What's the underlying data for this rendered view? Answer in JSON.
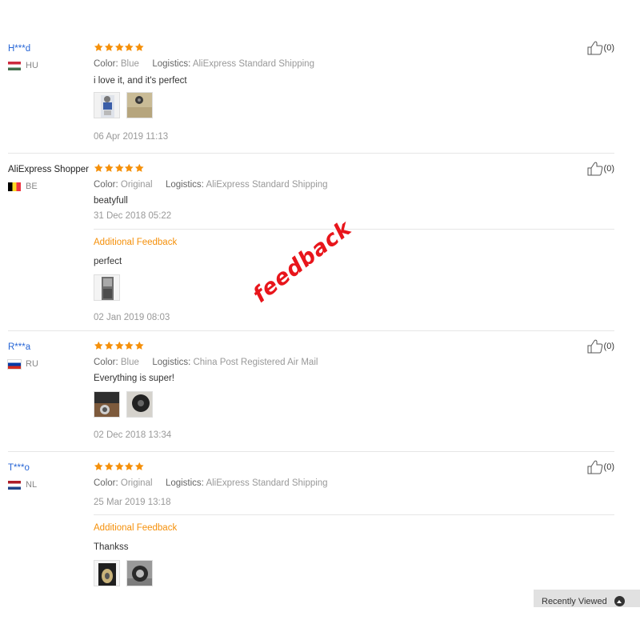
{
  "reviews": [
    {
      "user": "H***d",
      "country_code": "HU",
      "flag_colors": [
        "#cd2a3e",
        "#ffffff",
        "#436f4d"
      ],
      "rating": 5,
      "attributes": [
        {
          "label": "Color:",
          "value": "Blue"
        },
        {
          "label": "Logistics:",
          "value": "AliExpress Standard Shipping"
        }
      ],
      "text": "i love it, and it's perfect",
      "date": "06 Apr 2019 11:13",
      "useful_count": "(0)"
    },
    {
      "user": "AliExpress Shopper",
      "country_code": "BE",
      "flag_colors": [
        "#000000",
        "#fdda24",
        "#ef3340"
      ],
      "rating": 5,
      "attributes": [
        {
          "label": "Color:",
          "value": "Original"
        },
        {
          "label": "Logistics:",
          "value": "AliExpress Standard Shipping"
        }
      ],
      "text": "beatyfull",
      "date": "31 Dec 2018 05:22",
      "additional_label": "Additional Feedback",
      "additional_text": "perfect",
      "additional_date": "02 Jan 2019 08:03",
      "useful_count": "(0)"
    },
    {
      "user": "R***a",
      "country_code": "RU",
      "flag_colors": [
        "#ffffff",
        "#0039a6",
        "#d52b1e"
      ],
      "rating": 5,
      "attributes": [
        {
          "label": "Color:",
          "value": "Blue"
        },
        {
          "label": "Logistics:",
          "value": "China Post Registered Air Mail"
        }
      ],
      "text": "Everything is super!",
      "date": "02 Dec 2018 13:34",
      "useful_count": "(0)"
    },
    {
      "user": "T***o",
      "country_code": "NL",
      "flag_colors": [
        "#ae1c28",
        "#ffffff",
        "#21468b"
      ],
      "rating": 5,
      "attributes": [
        {
          "label": "Color:",
          "value": "Original"
        },
        {
          "label": "Logistics:",
          "value": "AliExpress Standard Shipping"
        }
      ],
      "date": "25 Mar 2019 13:18",
      "additional_label": "Additional Feedback",
      "additional_text": "Thankss",
      "useful_count": "(0)"
    }
  ],
  "watermark": "feedback",
  "recently_viewed": {
    "label": "Recently Viewed"
  },
  "colors": {
    "link_blue": "#2766d6",
    "star_orange": "#f5900a",
    "additional_orange": "#f5900a",
    "watermark_red": "#e8151b"
  }
}
